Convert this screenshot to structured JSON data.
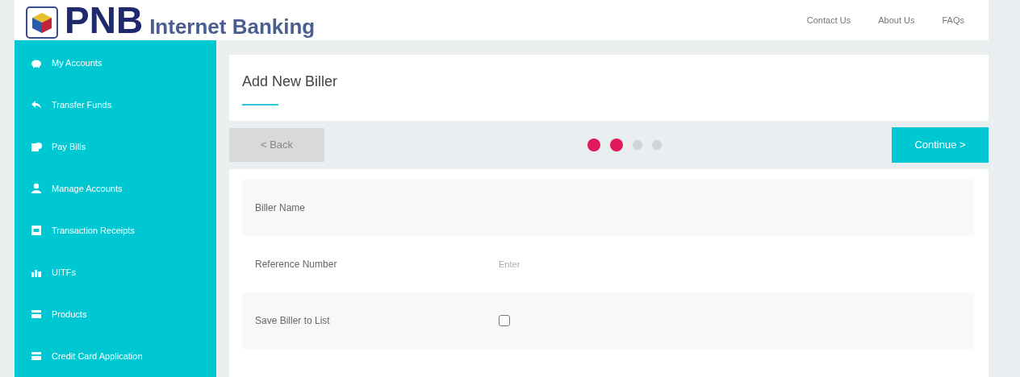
{
  "header": {
    "logo_text": "PNB",
    "logo_subtitle": "Internet Banking",
    "links": [
      "Contact Us",
      "About Us",
      "FAQs"
    ]
  },
  "sidebar": {
    "items": [
      {
        "label": "My Accounts"
      },
      {
        "label": "Transfer Funds"
      },
      {
        "label": "Pay Bills"
      },
      {
        "label": "Manage Accounts"
      },
      {
        "label": "Transaction Receipts"
      },
      {
        "label": "UITFs"
      },
      {
        "label": "Products"
      },
      {
        "label": "Credit Card Application"
      }
    ]
  },
  "page": {
    "title": "Add New Biller"
  },
  "steps": {
    "back": "< Back",
    "continue": "Continue >",
    "dots": [
      {
        "done": true
      },
      {
        "done": true
      },
      {
        "done": false
      },
      {
        "done": false
      }
    ]
  },
  "form": {
    "rows": [
      {
        "kind": "text",
        "label": "Biller Name"
      },
      {
        "kind": "input",
        "label": "Reference Number",
        "placeholder": "Enter"
      },
      {
        "kind": "checkbox",
        "label": "Save Biller to List",
        "checked": false
      }
    ]
  }
}
